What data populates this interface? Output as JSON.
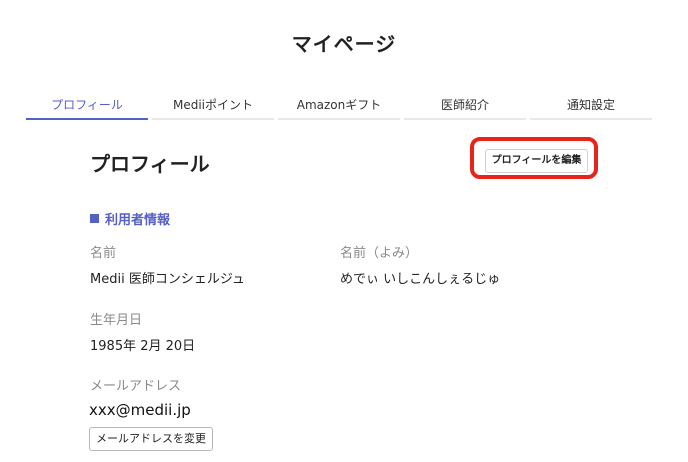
{
  "page": {
    "title": "マイページ"
  },
  "tabs": [
    {
      "label": "プロフィール",
      "active": true
    },
    {
      "label": "Mediiポイント",
      "active": false
    },
    {
      "label": "Amazonギフト",
      "active": false
    },
    {
      "label": "医師紹介",
      "active": false
    },
    {
      "label": "通知設定",
      "active": false
    }
  ],
  "profile": {
    "heading": "プロフィール",
    "edit_button": "プロフィールを編集",
    "highlight_color": "#e8241a",
    "accent_color": "#5560c4"
  },
  "user_info": {
    "heading": "利用者情報",
    "name_label": "名前",
    "name_value": "Medii 医師コンシェルジュ",
    "kana_label": "名前（よみ）",
    "kana_value": "めでぃ いしこんしぇるじゅ",
    "birth_label": "生年月日",
    "birth_value": "1985年 2月 20日",
    "email_label": "メールアドレス",
    "email_value": "xxx@medii.jp",
    "email_button": "メールアドレスを変更"
  }
}
